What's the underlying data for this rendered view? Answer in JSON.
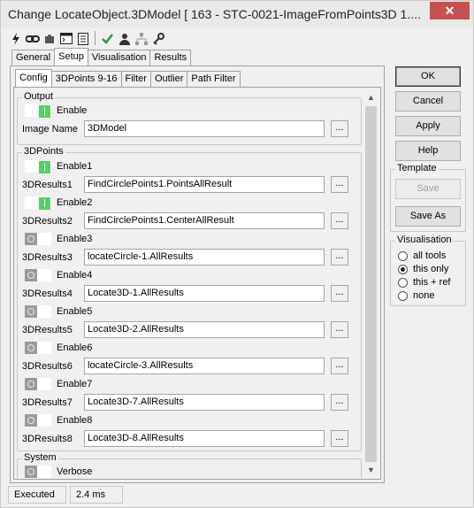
{
  "window": {
    "title": "Change LocateObject.3DModel [ 163 - STC-0021-ImageFromPoints3D 1....",
    "close_glyph": "✕"
  },
  "toolbar": {
    "icons": [
      "lightning-icon",
      "link-icon",
      "puzzle-icon",
      "console-icon",
      "list-icon",
      "checkmark-icon",
      "person-icon",
      "network-icon",
      "key-icon"
    ]
  },
  "outer_tabs": [
    "General",
    "Setup",
    "Visualisation",
    "Results"
  ],
  "outer_active": "Setup",
  "inner_tabs": [
    "Config",
    "3DPoints 9-16",
    "Filter",
    "Outlier",
    "Path Filter"
  ],
  "inner_active": "Config",
  "output": {
    "title": "Output",
    "enable_label": "Enable",
    "image_name_label": "Image Name",
    "image_name_value": "3DModel"
  },
  "points": {
    "title": "3DPoints",
    "rows": [
      {
        "enable_label": "Enable1",
        "enabled": true,
        "result_label": "3DResults1",
        "value": "FindCirclePoints1.PointsAllResult"
      },
      {
        "enable_label": "Enable2",
        "enabled": true,
        "result_label": "3DResults2",
        "value": "FindCirclePoints1.CenterAllResult"
      },
      {
        "enable_label": "Enable3",
        "enabled": false,
        "result_label": "3DResults3",
        "value": "locateCircle-1.AllResults"
      },
      {
        "enable_label": "Enable4",
        "enabled": false,
        "result_label": "3DResults4",
        "value": "Locate3D-1.AllResults"
      },
      {
        "enable_label": "Enable5",
        "enabled": false,
        "result_label": "3DResults5",
        "value": "Locate3D-2.AllResults"
      },
      {
        "enable_label": "Enable6",
        "enabled": false,
        "result_label": "3DResults6",
        "value": "locateCircle-3.AllResults"
      },
      {
        "enable_label": "Enable7",
        "enabled": false,
        "result_label": "3DResults7",
        "value": "Locate3D-7.AllResults"
      },
      {
        "enable_label": "Enable8",
        "enabled": false,
        "result_label": "3DResults8",
        "value": "Locate3D-8.AllResults"
      }
    ]
  },
  "system": {
    "title": "System",
    "verbose_label": "Verbose"
  },
  "dots_label": "...",
  "buttons": {
    "ok": "OK",
    "cancel": "Cancel",
    "apply": "Apply",
    "help": "Help"
  },
  "template": {
    "title": "Template",
    "save": "Save",
    "save_as": "Save As"
  },
  "visualisation": {
    "title": "Visualisation",
    "options": [
      "all tools",
      "this only",
      "this + ref",
      "none"
    ],
    "selected": "this only"
  },
  "status": {
    "state": "Executed",
    "time": "2.4 ms"
  }
}
